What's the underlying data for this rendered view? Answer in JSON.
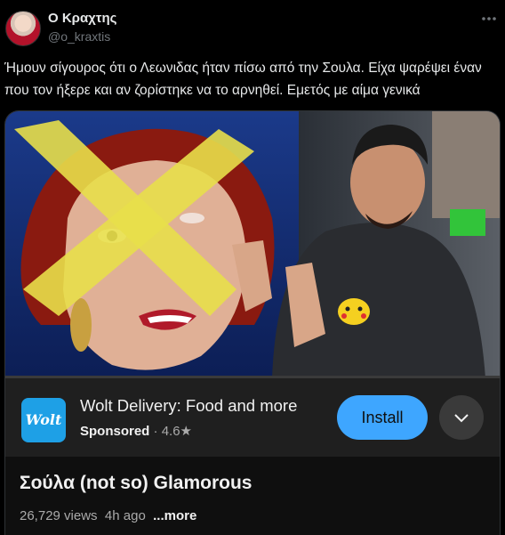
{
  "author": {
    "name": "Ο Κραχτης",
    "handle": "@o_kraxtis",
    "more_icon": "more-horizontal-icon"
  },
  "tweet": {
    "text": "Ήμουν σίγουρος ότι ο Λεωνιδας ήταν πίσω από την Σουλα. Είχα  ψαρέψει έναν που τον ήξερε και αν ζορίστηκε να το αρνηθεί. Εμετός με αίμα γενικά"
  },
  "video": {
    "progress_fraction": 0.0,
    "title": "Σούλα (not so) Glamorous",
    "views": "26,729 views",
    "age": "4h ago",
    "more_label": "...more"
  },
  "ad": {
    "logo_text": "Wolt",
    "title": "Wolt Delivery: Food and more",
    "sponsored": "Sponsored",
    "separator": "·",
    "rating": "4.6",
    "star_icon": "star-icon",
    "install_label": "Install",
    "expand_icon": "chevron-down-icon",
    "brand_color": "#1ea0e6",
    "button_color": "#3ea6ff"
  }
}
